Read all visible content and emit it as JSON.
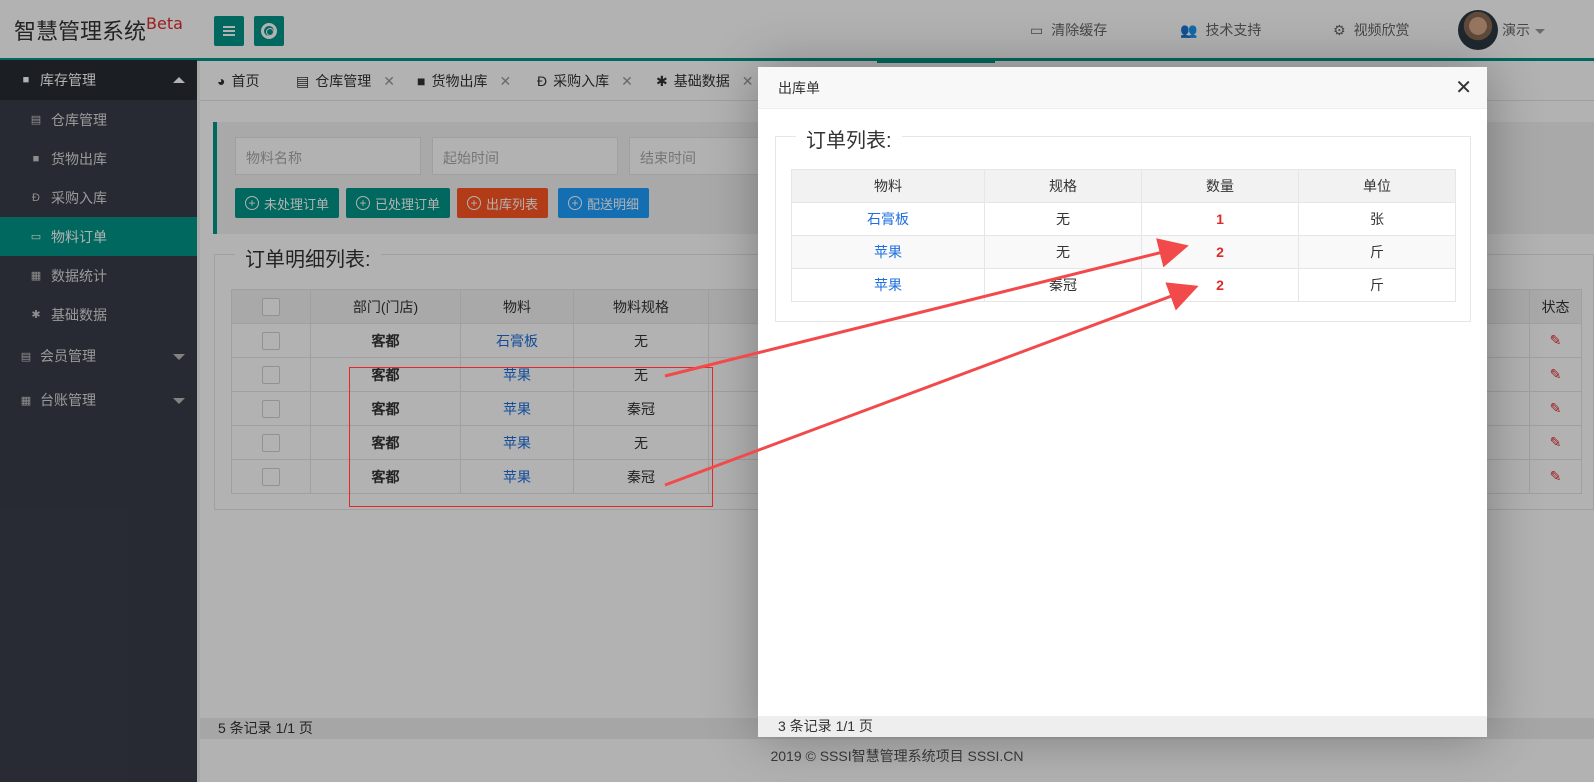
{
  "header": {
    "logo": "智慧管理系统",
    "beta": "Beta",
    "items": [
      {
        "label": "清除缓存",
        "icon": "monitor-icon"
      },
      {
        "label": "技术支持",
        "icon": "users-icon"
      },
      {
        "label": "视频欣赏",
        "icon": "gears-icon"
      }
    ],
    "user_name": "演示"
  },
  "sidebar": {
    "groups": [
      {
        "label": "库存管理",
        "icon": "folder-icon",
        "expanded": true
      },
      {
        "label": "会员管理",
        "icon": "id-card-icon",
        "expanded": false
      },
      {
        "label": "台账管理",
        "icon": "calendar-icon",
        "expanded": false
      }
    ],
    "items": [
      {
        "label": "仓库管理",
        "icon": "file-icon"
      },
      {
        "label": "货物出库",
        "icon": "folder-icon"
      },
      {
        "label": "采购入库",
        "icon": "coin-icon"
      },
      {
        "label": "物料订单",
        "icon": "monitor-icon",
        "active": true
      },
      {
        "label": "数据统计",
        "icon": "calendar-icon"
      },
      {
        "label": "基础数据",
        "icon": "gear-icon"
      }
    ]
  },
  "tabs": [
    {
      "label": "首页",
      "icon": "dashboard-icon"
    },
    {
      "label": "仓库管理",
      "icon": "file-icon"
    },
    {
      "label": "货物出库",
      "icon": "folder-icon"
    },
    {
      "label": "采购入库",
      "icon": "coin-icon"
    },
    {
      "label": "基础数据",
      "icon": "gear-icon"
    }
  ],
  "search": {
    "placeholder_material": "物料名称",
    "placeholder_start": "起始时间",
    "placeholder_end": "结束时间",
    "buttons": [
      {
        "label": "未处理订单",
        "color": "#009688"
      },
      {
        "label": "已处理订单",
        "color": "#009688"
      },
      {
        "label": "出库列表",
        "color": "#ff5722"
      },
      {
        "label": "配送明细",
        "color": "#1e9fff"
      }
    ]
  },
  "order_list": {
    "legend": "订单明细列表:",
    "columns": [
      "部门(门店)",
      "物料",
      "物料规格",
      "状态"
    ],
    "rows": [
      {
        "dept": "客都",
        "material": "石膏板",
        "spec": "无"
      },
      {
        "dept": "客都",
        "material": "苹果",
        "spec": "无"
      },
      {
        "dept": "客都",
        "material": "苹果",
        "spec": "秦冠"
      },
      {
        "dept": "客都",
        "material": "苹果",
        "spec": "无"
      },
      {
        "dept": "客都",
        "material": "苹果",
        "spec": "秦冠"
      }
    ],
    "footer": "5 条记录 1/1 页"
  },
  "copyright": "2019 ©  SSSI智慧管理系统项目  SSSI.CN",
  "modal": {
    "title": "出库单",
    "legend": "订单列表:",
    "columns": [
      "物料",
      "规格",
      "数量",
      "单位"
    ],
    "rows": [
      {
        "material": "石膏板",
        "spec": "无",
        "qty": "1",
        "unit": "张"
      },
      {
        "material": "苹果",
        "spec": "无",
        "qty": "2",
        "unit": "斤"
      },
      {
        "material": "苹果",
        "spec": "秦冠",
        "qty": "2",
        "unit": "斤"
      }
    ],
    "footer": "3 条记录 1/1 页"
  },
  "colors": {
    "primary": "#009688",
    "sidebar": "#393d49",
    "danger": "#e02a2a",
    "link": "#1e6fdf"
  }
}
